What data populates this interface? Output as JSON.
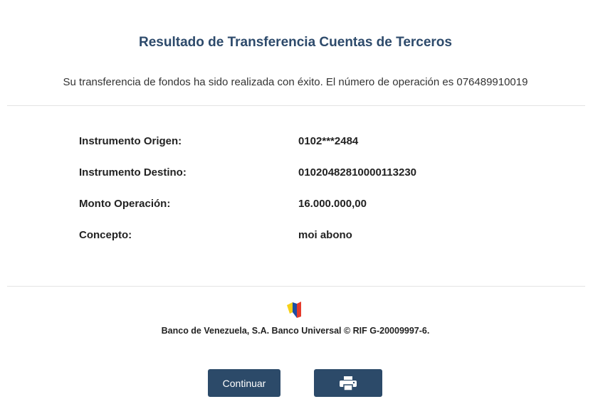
{
  "header": {
    "title": "Resultado de Transferencia Cuentas de Terceros"
  },
  "message": "Su transferencia de fondos ha sido realizada con éxito. El número de operación es 076489910019",
  "details": [
    {
      "label": "Instrumento Origen:",
      "value": "0102***2484"
    },
    {
      "label": "Instrumento Destino:",
      "value": "01020482810000113230"
    },
    {
      "label": "Monto Operación:",
      "value": "16.000.000,00"
    },
    {
      "label": "Concepto:",
      "value": "moi abono"
    }
  ],
  "footer": {
    "logo_icon": "banco-de-venezuela-logo-icon",
    "text": "Banco de Venezuela, S.A. Banco Universal © RIF G-20009997-6."
  },
  "actions": {
    "continue_label": "Continuar",
    "print_icon": "printer-icon"
  },
  "colors": {
    "title": "#2d4a6b",
    "button_bg": "#2c4a69",
    "divider": "#e4e4e4",
    "logo_yellow": "#f7d117",
    "logo_blue": "#1d4fa3",
    "logo_red": "#e53b2c"
  }
}
